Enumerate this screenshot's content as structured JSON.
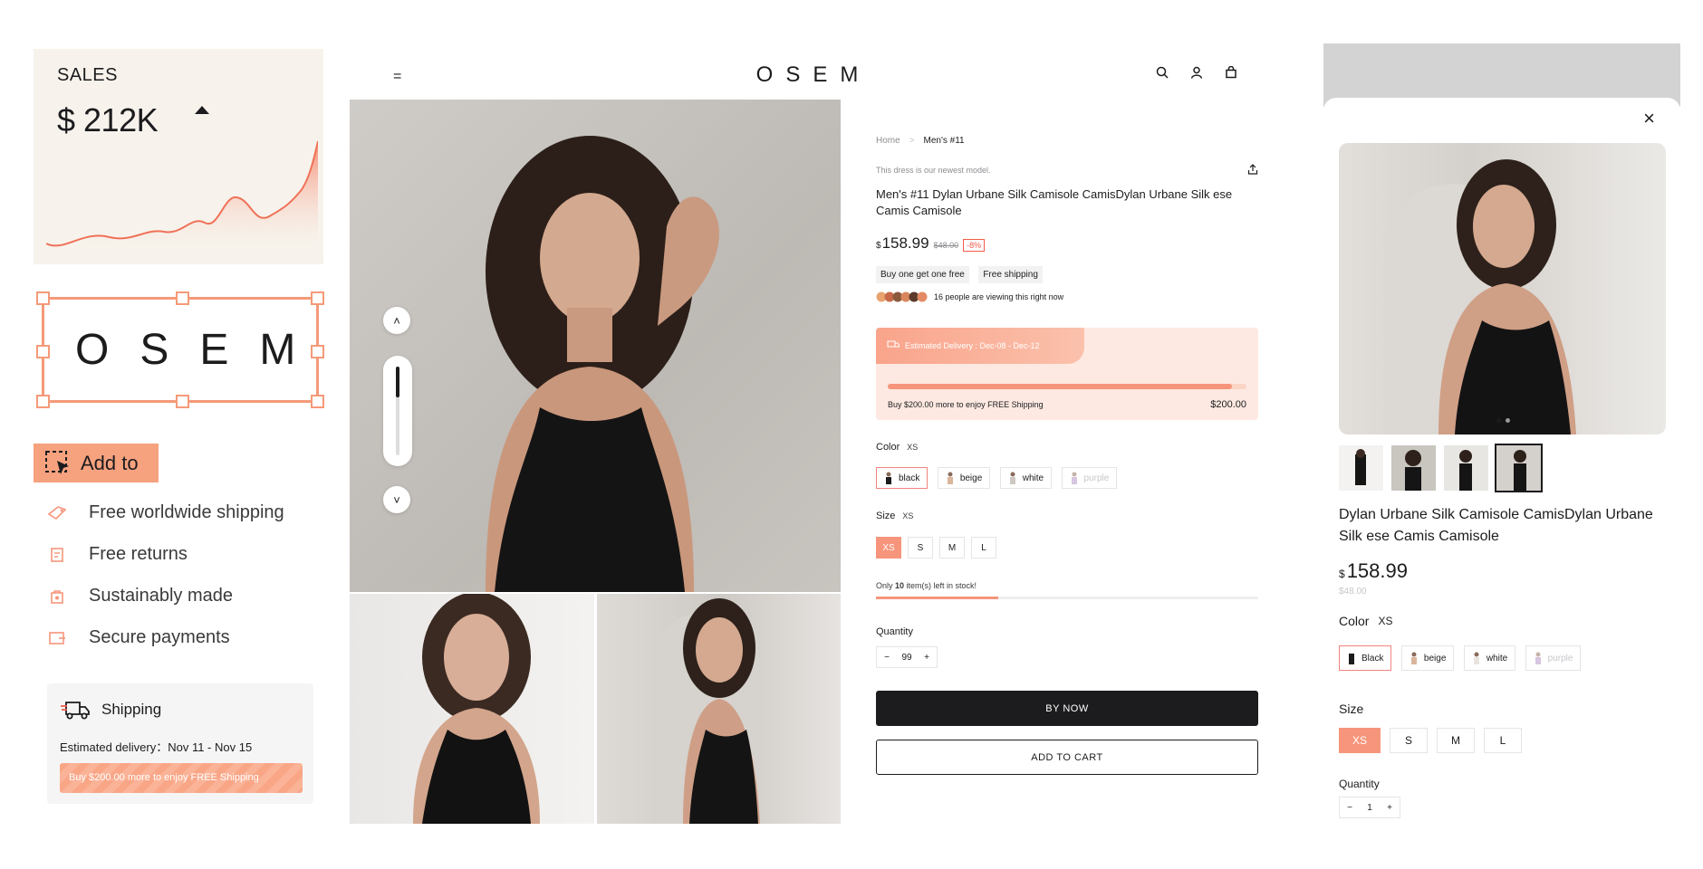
{
  "sales_card": {
    "label": "SALES",
    "value": "$ 212K"
  },
  "brand": {
    "logo": "OSEM"
  },
  "add_badge": {
    "label": "Add to"
  },
  "features": [
    {
      "icon": "tag-icon",
      "label": "Free worldwide shipping"
    },
    {
      "icon": "returns-icon",
      "label": "Free returns"
    },
    {
      "icon": "leaf-bag-icon",
      "label": "Sustainably made"
    },
    {
      "icon": "card-icon",
      "label": "Secure payments"
    }
  ],
  "shipping_card": {
    "title": "Shipping",
    "delivery": "Estimated delivery：Nov 11 - Nov 15",
    "banner": "Buy $200.00 more to enjoy FREE Shipping"
  },
  "header": {
    "menu_icon": "=",
    "logo": "OSEM"
  },
  "product": {
    "breadcrumb": {
      "home": "Home",
      "sep": ">",
      "current": "Men's #11"
    },
    "subtitle": "This dress is our newest model.",
    "title": "Men's #11 Dylan Urbane Silk Camisole CamisDylan Urbane Silk ese Camis Camisole",
    "currency": "$",
    "price": "158.99",
    "old_price": "$48.00",
    "discount": "-8%",
    "tags": [
      "Buy one get one free",
      "Free shipping"
    ],
    "viewers": "16 people are viewing this right now",
    "delivery": {
      "estimate": "Estimated Delivery : Dec-08 - Dec-12",
      "progress_text": "Buy $200.00 more to enjoy FREE Shipping",
      "amount": "$200.00",
      "progress": 0.96
    },
    "color": {
      "label": "Color",
      "value": "XS",
      "options": [
        "black",
        "beige",
        "white",
        "purple"
      ]
    },
    "size": {
      "label": "Size",
      "value": "XS",
      "options": [
        "XS",
        "S",
        "M",
        "L"
      ]
    },
    "stock": {
      "prefix": "Only ",
      "count": "10",
      "suffix": " item(s) left in stock!",
      "level": 0.32
    },
    "quantity": {
      "label": "Quantity",
      "minus": "−",
      "value": "99",
      "plus": "+"
    },
    "buy_label": "BY NOW",
    "cart_label": "ADD TO CART"
  },
  "modal": {
    "close": "×",
    "title": "Dylan Urbane Silk Camisole CamisDylan Urbane Silk ese  Camis Camisole",
    "currency": "$",
    "price": "158.99",
    "old_price": "$48.00",
    "color": {
      "label": "Color",
      "value": "XS",
      "options": [
        "Black",
        "beige",
        "white",
        "purple"
      ]
    },
    "size": {
      "label": "Size",
      "options": [
        "XS",
        "S",
        "M",
        "L"
      ]
    },
    "quantity": {
      "label": "Quantity",
      "minus": "−",
      "value": "1",
      "plus": "+"
    }
  },
  "colors": {
    "accent": "#f6957b",
    "accent_light": "#fde4d9",
    "dark": "#1c1c1e"
  }
}
